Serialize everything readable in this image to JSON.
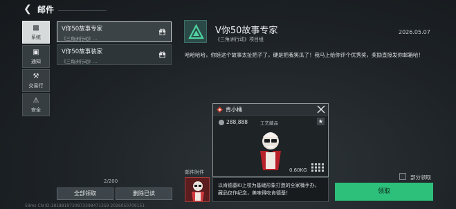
{
  "header": {
    "title": "邮件"
  },
  "sidebar": {
    "items": [
      {
        "label": "系统",
        "icon": "system-icon",
        "active": true
      },
      {
        "label": "通知",
        "icon": "notice-icon",
        "active": false
      },
      {
        "label": "交易行",
        "icon": "hammer-icon",
        "active": false
      },
      {
        "label": "安全",
        "icon": "warning-icon",
        "active": false
      }
    ]
  },
  "mail_list": {
    "items": [
      {
        "title": "V你50故事专家",
        "sub": "《三角洲行动》...",
        "selected": true
      },
      {
        "title": "V你50故事装家",
        "sub": "《三角洲行动》...",
        "selected": false
      }
    ],
    "pager": "2/200",
    "delete_all_label": "全部领取",
    "delete_read_label": "删除已读"
  },
  "status": {
    "text": "59ms   CN ID:1818819730873398471359   2026050709151"
  },
  "mail": {
    "title": "V你50故事专家",
    "sender": "《三角洲行动》项目组",
    "date": "2026.05.07",
    "body": "哈哈哈哈，你娃这个故事太扯把子了，硬是把我笑瓜了！我马上给你评个优秀奖，奖励直接发你邮箱哈！"
  },
  "popup": {
    "title": "肯小桶",
    "price": "288,888",
    "category": "工艺藏品",
    "weight": "0.60KG"
  },
  "attachments": {
    "label": "邮件附件",
    "description": "以肯德基KI上校为基础形象打造的全家桶手办，藏品仅作纪念，美味得吃肯德基！"
  },
  "actions": {
    "partial_claim_label": "部分领取",
    "claim_label": "领取"
  },
  "colors": {
    "accent": "#2cc07a",
    "logo": "#2b4a47",
    "rarity": "#c0392b"
  }
}
